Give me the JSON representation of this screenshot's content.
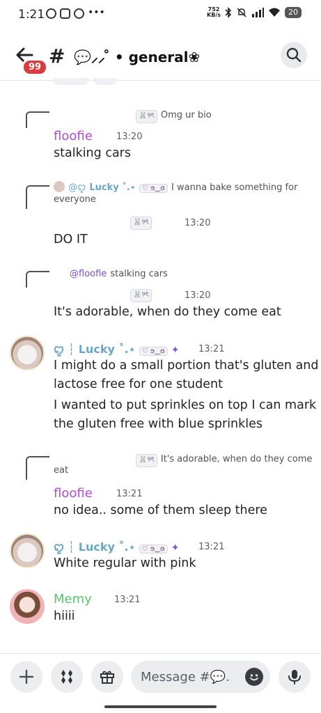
{
  "status_bar": {
    "time": "1:21",
    "network_speed_value": "752",
    "network_speed_unit": "KB/s",
    "battery": "20",
    "icons": [
      "whatsapp-icon",
      "instagram-icon",
      "messenger-icon",
      "bluetooth-icon",
      "mute-icon",
      "signal-icon",
      "wifi-icon",
      "battery-icon"
    ]
  },
  "header": {
    "unread_badge": "99",
    "hash": "#",
    "channel_name": "💬⸝⸝ ̊ • general❀",
    "chevron": "›"
  },
  "messages": [
    {
      "reply": {
        "tag": "🐰୨ৎ",
        "text": "Omg ur bio"
      },
      "author": "floofie",
      "time": "13:20",
      "text": "stalking cars"
    },
    {
      "reply": {
        "mention": "@ꨄ︎",
        "author_tag": "Lucky ˚.⋆",
        "tag": "♡ ɘ‿ɞ",
        "text_line1": "I wanna bake something for",
        "text_line2": "everyone"
      },
      "author_tag": "🐰୨ৎ",
      "time": "13:20",
      "text": "DO IT"
    },
    {
      "reply": {
        "mention": "@floofie",
        "text": "stalking cars"
      },
      "author_tag": "🐰୨ৎ",
      "time": "13:20",
      "text": "It's adorable, when do they come eat"
    },
    {
      "author": "ꨄ︎ ┆ Lucky ˚.⋆",
      "tag": "♡ ɘ‿ɞ",
      "time": "13:21",
      "lines": [
        "I might do a small portion that's gluten and",
        "lactose free for one student",
        "I wanted to put sprinkles on top I can mark",
        "the gluten free with blue sprinkles"
      ]
    },
    {
      "reply": {
        "tag": "🐰୨ৎ",
        "text_line1": "It's adorable, when do they come",
        "text_line2": "eat"
      },
      "author": "floofie",
      "time": "13:21",
      "text": "no idea.. some of them sleep there"
    },
    {
      "author": "ꨄ︎ ┆ Lucky ˚.⋆",
      "tag": "♡ ɘ‿ɞ",
      "time": "13:21",
      "text": "White regular with pink"
    },
    {
      "author": "Memy",
      "time": "13:21",
      "text": "hiiii"
    }
  ],
  "composer": {
    "placeholder": "Message #💬...",
    "icons": [
      "plus-icon",
      "apps-icon",
      "gift-icon",
      "emoji-icon",
      "microphone-icon"
    ]
  },
  "colors": {
    "floofie": "#b24bd8",
    "lucky": "#6ba6c9",
    "memy": "#5bc46a",
    "badge": "#d83c3e"
  }
}
